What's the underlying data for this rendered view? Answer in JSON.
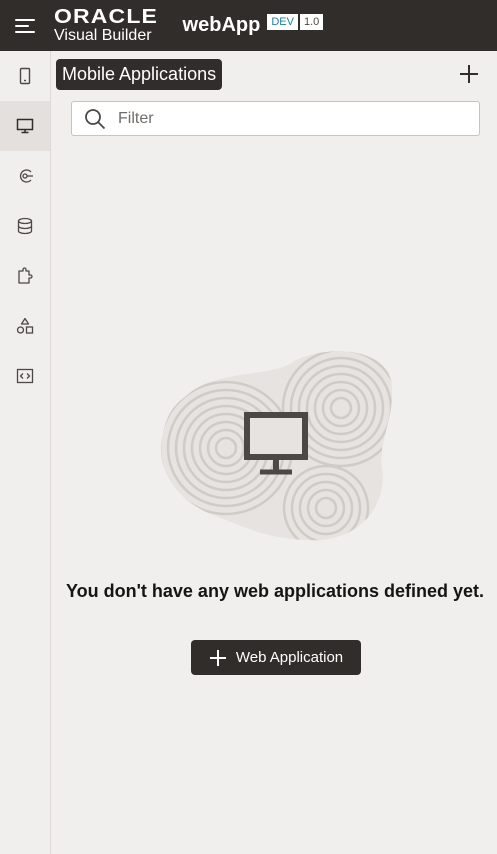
{
  "header": {
    "brand_line1": "ORACLE",
    "brand_line2": "Visual Builder",
    "app_name": "webApp",
    "badge_env": "DEV",
    "badge_version": "1.0"
  },
  "rail": {
    "items": [
      {
        "icon": "mobile-icon"
      },
      {
        "icon": "desktop-icon",
        "active": true
      },
      {
        "icon": "service-connection-icon"
      },
      {
        "icon": "database-icon"
      },
      {
        "icon": "component-icon"
      },
      {
        "icon": "shapes-icon"
      },
      {
        "icon": "code-icon"
      }
    ]
  },
  "panel": {
    "title": "Mobile Applications",
    "filter_placeholder": "Filter"
  },
  "empty_state": {
    "message": "You don't have any web applications defined yet.",
    "button_label": "Web Application"
  }
}
